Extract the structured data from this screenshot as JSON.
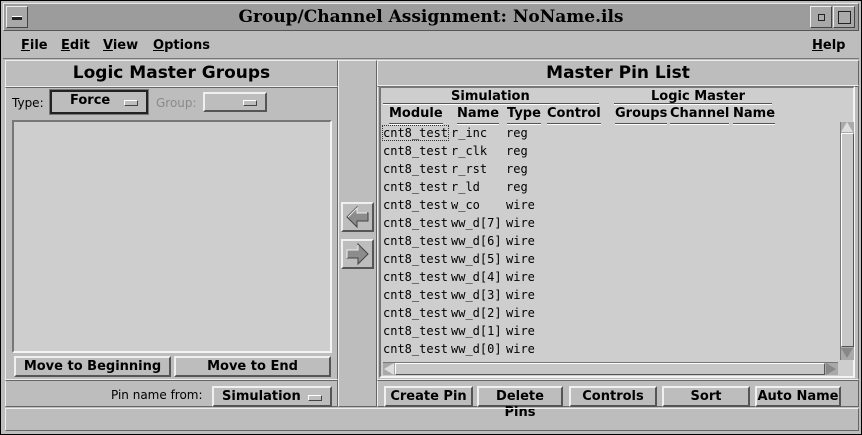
{
  "window": {
    "title": "Group/Channel Assignment: NoName.ils"
  },
  "menubar": {
    "file": "File",
    "edit": "Edit",
    "view": "View",
    "options": "Options",
    "help": "Help"
  },
  "left_panel": {
    "heading": "Logic Master Groups",
    "type_label": "Type:",
    "type_value": "Force",
    "group_label": "Group:",
    "group_value": "",
    "move_to_beginning": "Move to Beginning",
    "move_to_end": "Move to End",
    "pin_name_from_label": "Pin name from:",
    "pin_name_from_value": "Simulation"
  },
  "right_panel": {
    "heading": "Master Pin List",
    "simulation_group": "Simulation",
    "logic_master_group": "Logic Master",
    "columns": [
      "Module",
      "Name",
      "Type",
      "Control",
      "Groups",
      "Channel",
      "Name"
    ],
    "rows": [
      {
        "module": "cnt8_test",
        "name": "r_inc",
        "type": "reg"
      },
      {
        "module": "cnt8_test",
        "name": "r_clk",
        "type": "reg"
      },
      {
        "module": "cnt8_test",
        "name": "r_rst",
        "type": "reg"
      },
      {
        "module": "cnt8_test",
        "name": "r_ld",
        "type": "reg"
      },
      {
        "module": "cnt8_test",
        "name": "w_co",
        "type": "wire"
      },
      {
        "module": "cnt8_test",
        "name": "ww_d[7]",
        "type": "wire"
      },
      {
        "module": "cnt8_test",
        "name": "ww_d[6]",
        "type": "wire"
      },
      {
        "module": "cnt8_test",
        "name": "ww_d[5]",
        "type": "wire"
      },
      {
        "module": "cnt8_test",
        "name": "ww_d[4]",
        "type": "wire"
      },
      {
        "module": "cnt8_test",
        "name": "ww_d[3]",
        "type": "wire"
      },
      {
        "module": "cnt8_test",
        "name": "ww_d[2]",
        "type": "wire"
      },
      {
        "module": "cnt8_test",
        "name": "ww_d[1]",
        "type": "wire"
      },
      {
        "module": "cnt8_test",
        "name": "ww_d[0]",
        "type": "wire"
      }
    ],
    "buttons": {
      "create_pin": "Create Pin",
      "delete_pins": "Delete Pins",
      "controls": "Controls",
      "sort": "Sort",
      "auto_name": "Auto Name"
    }
  },
  "icons": {
    "left_arrow": "arrow-left-icon",
    "right_arrow": "arrow-right-icon"
  }
}
